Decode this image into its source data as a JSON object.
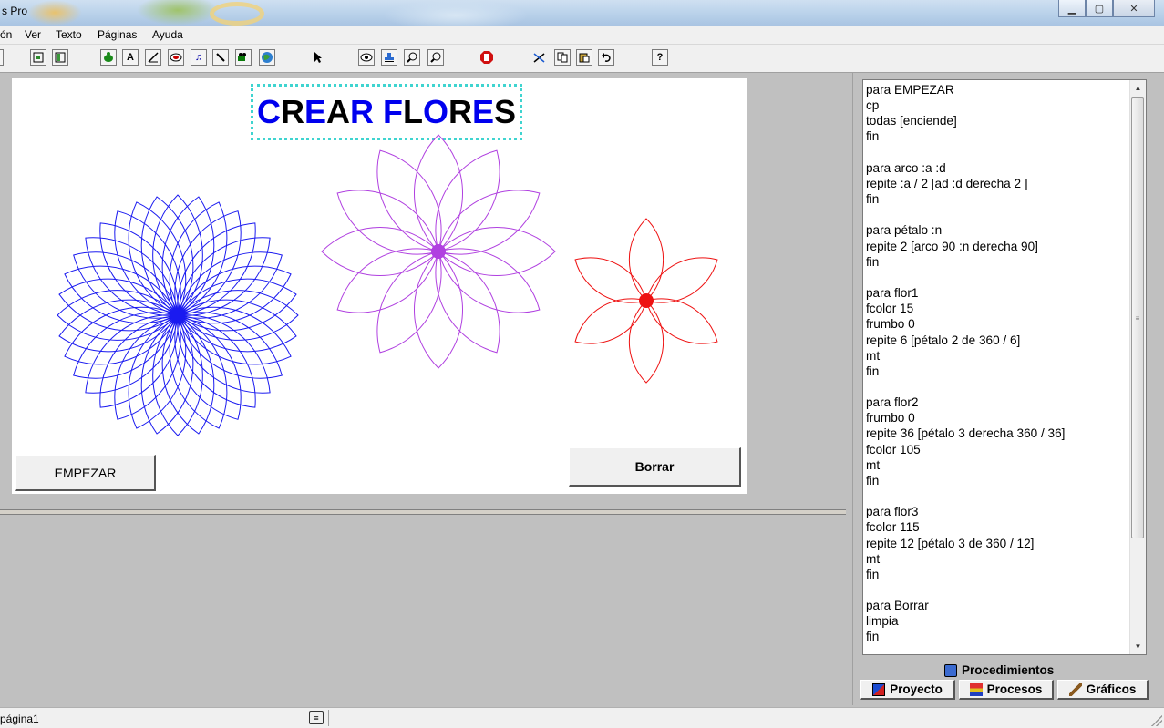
{
  "window": {
    "title": "s Pro",
    "buttons": {
      "minimize": "▁",
      "maximize": "▢",
      "close": "✕"
    }
  },
  "menu": {
    "items": [
      "ón",
      "Ver",
      "Texto",
      "Páginas",
      "Ayuda"
    ]
  },
  "toolbar": {
    "icons": [
      "page-view-icon",
      "book-icon",
      "turtle-icon",
      "text-box-icon",
      "slider-icon",
      "button-icon",
      "music-icon",
      "pencil-icon",
      "video-icon",
      "globe-icon",
      "pointer-icon",
      "eye-icon",
      "stamp-icon",
      "zoom-in-icon",
      "zoom-out-icon",
      "stop-icon",
      "scissors-icon",
      "copy-icon",
      "paste-icon",
      "undo-icon",
      "help-icon"
    ]
  },
  "canvas": {
    "title": {
      "parts": [
        {
          "text": "C",
          "color": "#0000ee"
        },
        {
          "text": "R",
          "color": "#000000"
        },
        {
          "text": "E",
          "color": "#0000ee"
        },
        {
          "text": "A",
          "color": "#000000"
        },
        {
          "text": "R",
          "color": "#0000ee"
        },
        {
          "text": " ",
          "color": "#000000"
        },
        {
          "text": "F",
          "color": "#0000ee"
        },
        {
          "text": "L",
          "color": "#000000"
        },
        {
          "text": "O",
          "color": "#0000ee"
        },
        {
          "text": "R",
          "color": "#000000"
        },
        {
          "text": "E",
          "color": "#0000ee"
        },
        {
          "text": "S",
          "color": "#000000"
        }
      ]
    },
    "flowers": [
      {
        "name": "flor2",
        "petals": 36,
        "color": "#1a1af0"
      },
      {
        "name": "flor3",
        "petals": 12,
        "color": "#b040e0"
      },
      {
        "name": "flor1",
        "petals": 6,
        "color": "#ee1111"
      }
    ],
    "start_button": "EMPEZAR",
    "clear_button": "Borrar"
  },
  "editor": {
    "code": "para EMPEZAR\ncp\ntodas [enciende]\nfin\n\npara arco :a :d\nrepite :a / 2 [ad :d derecha 2 ]\nfin\n\npara pétalo :n\nrepite 2 [arco 90 :n derecha 90]\nfin\n\npara flor1\nfcolor 15\nfrumbo 0\nrepite 6 [pétalo 2 de 360 / 6]\nmt\nfin\n\npara flor2\nfrumbo 0\nrepite 36 [pétalo 3 derecha 360 / 36]\nfcolor 105\nmt\nfin\n\npara flor3\nfcolor 115\nrepite 12 [pétalo 3 de 360 / 12]\nmt\nfin\n\npara Borrar\nlimpia\nfin"
  },
  "procedures_label": "Procedimientos",
  "tabs": [
    {
      "label": "Proyecto",
      "icon": "project-icon"
    },
    {
      "label": "Procesos",
      "icon": "processes-icon"
    },
    {
      "label": "Gráficos",
      "icon": "graphics-icon"
    }
  ],
  "status": {
    "page": "página1"
  }
}
